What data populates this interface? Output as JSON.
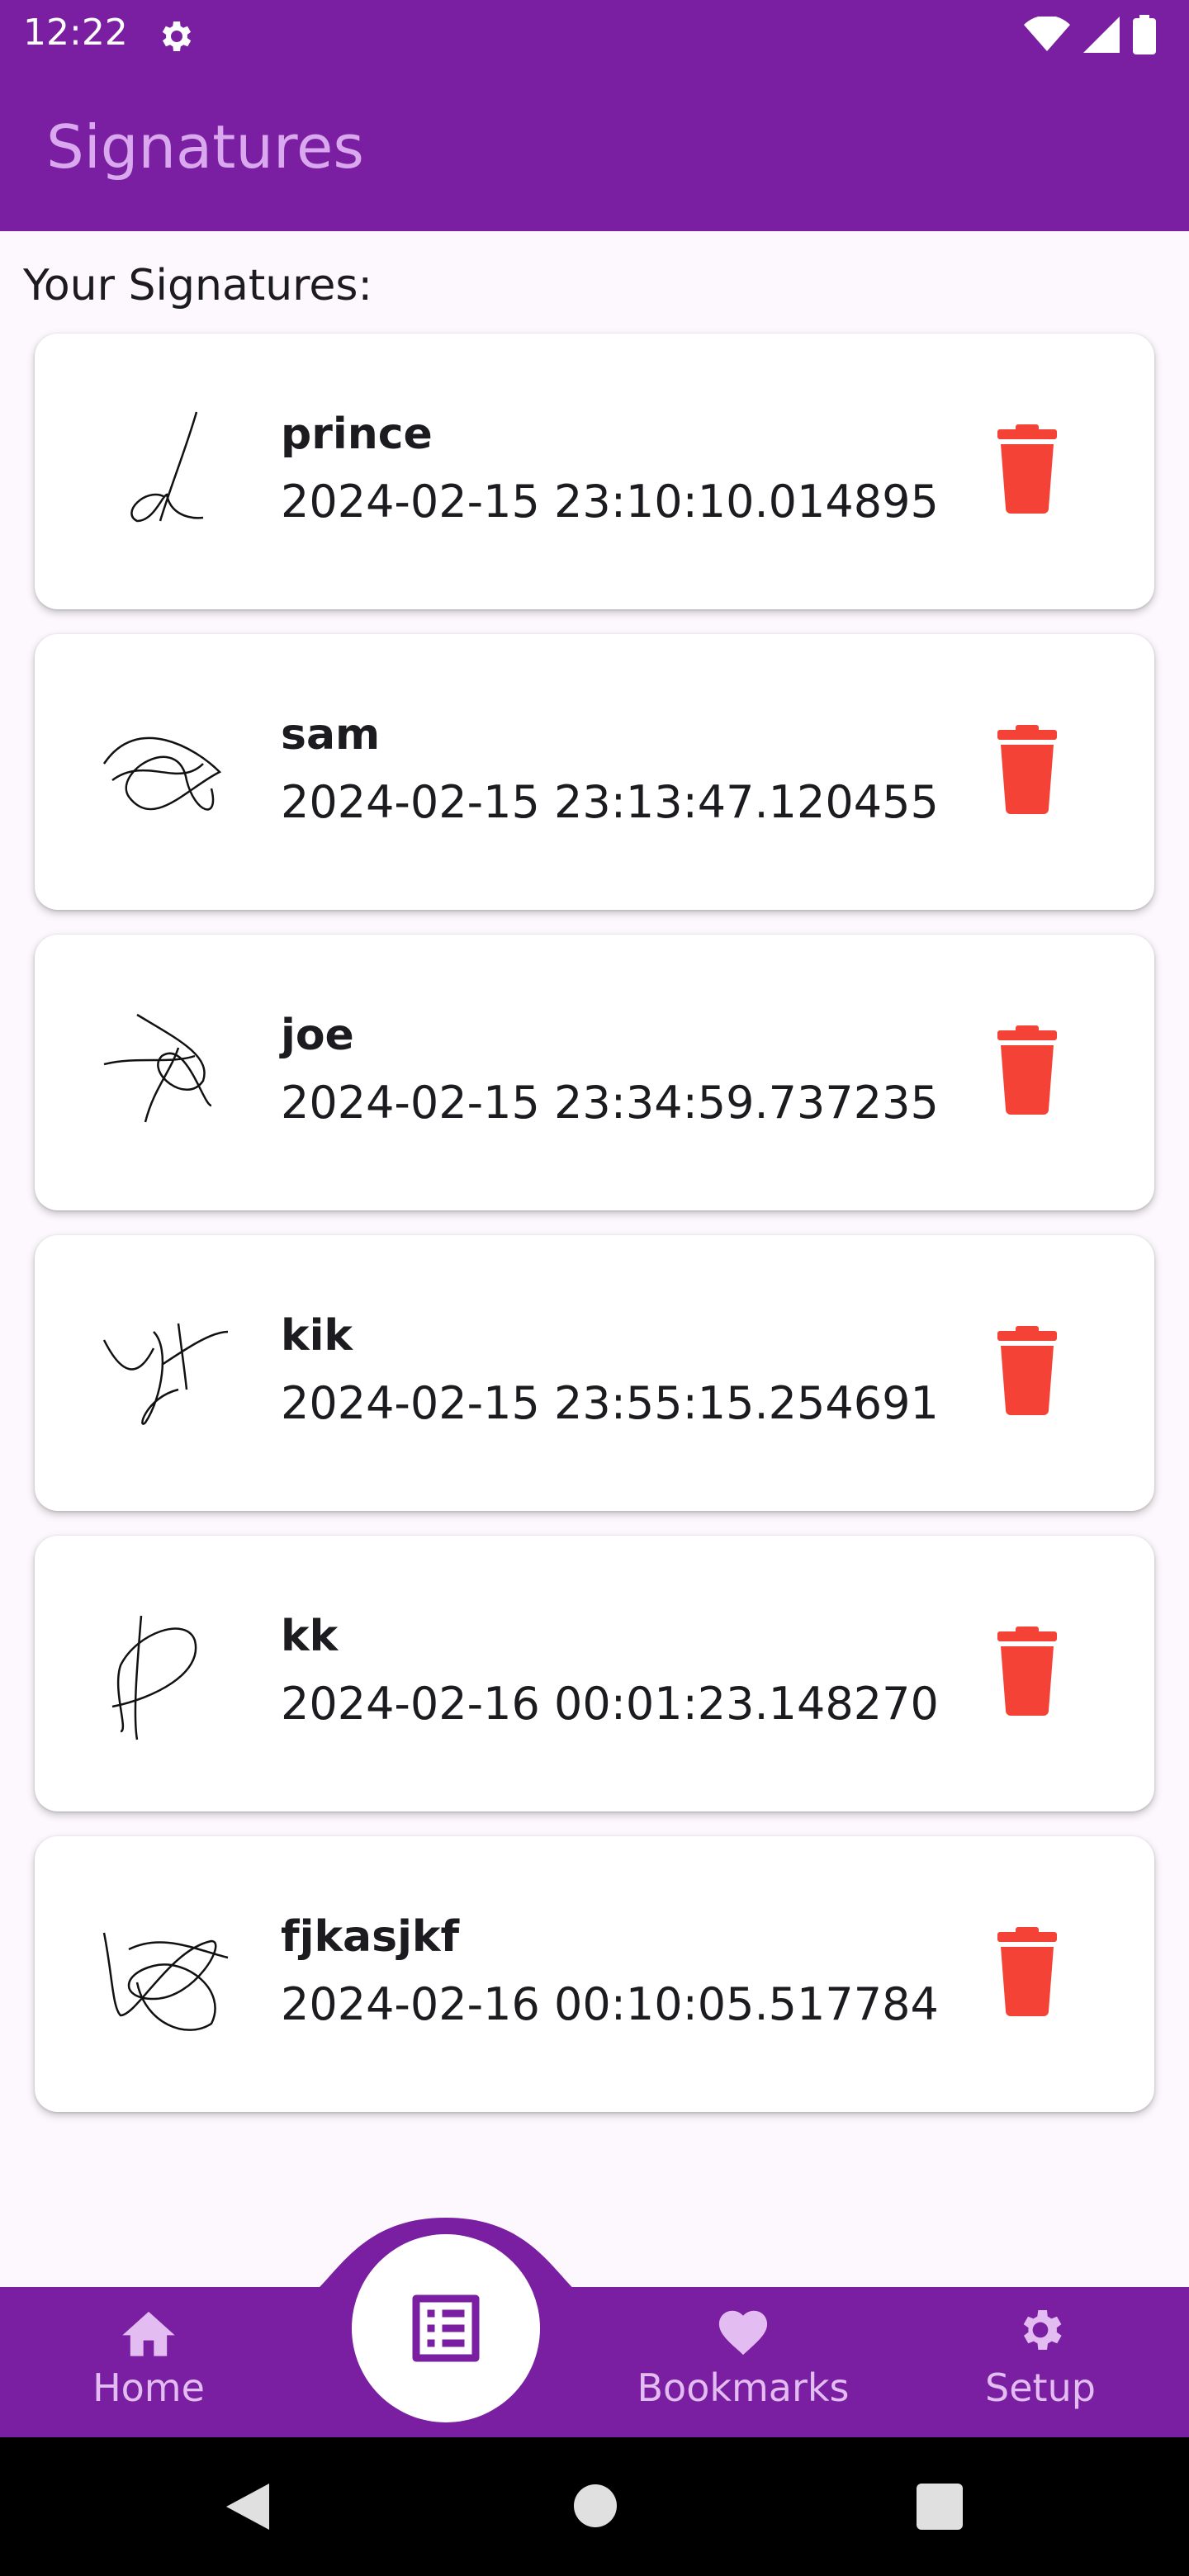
{
  "status_bar": {
    "time": "12:22",
    "icons": [
      "gear-icon",
      "wifi-icon",
      "signal-icon",
      "battery-icon"
    ]
  },
  "app_bar": {
    "title": "Signatures"
  },
  "section_label": "Your Signatures:",
  "signatures": [
    {
      "name": "prince",
      "date": "2024-02-15 23:10:10.014895"
    },
    {
      "name": "sam",
      "date": "2024-02-15 23:13:47.120455"
    },
    {
      "name": "joe",
      "date": "2024-02-15 23:34:59.737235"
    },
    {
      "name": "kik",
      "date": "2024-02-15 23:55:15.254691"
    },
    {
      "name": "kk",
      "date": "2024-02-16 00:01:23.148270"
    },
    {
      "name": "fjkasjkf",
      "date": "2024-02-16 00:10:05.517784"
    }
  ],
  "bottom_nav": {
    "home": "Home",
    "bookmarks": "Bookmarks",
    "setup": "Setup",
    "center_icon": "list-alt-icon"
  },
  "colors": {
    "primary": "#7b1fa2",
    "delete": "#f44336",
    "nav_text": "#e3bdf2",
    "title_text": "#d9a8ee"
  }
}
